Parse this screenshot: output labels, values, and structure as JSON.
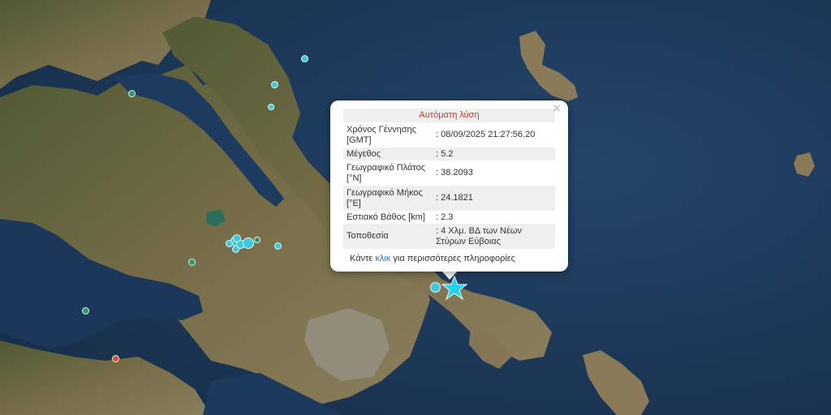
{
  "popup": {
    "title": "Αυτόματη λύση",
    "close_label": "×",
    "rows": [
      {
        "key": "Χρόνος Γέννησης [GMT]",
        "value": ": 08/09/2025 21:27:56.20"
      },
      {
        "key": "Μέγεθος",
        "value": ": 5.2"
      },
      {
        "key": "Γεωγραφικό Πλάτος [°N]",
        "value": ": 38.2093"
      },
      {
        "key": "Γεωγραφικό Μήκος [°E]",
        "value": ": 24.1821"
      },
      {
        "key": "Εστιακό Βάθος [km]",
        "value": ": 2.3"
      },
      {
        "key": "Τοποθεσία",
        "value": ": 4 Χλμ. ΒΔ των Νέων Στύρων Εύβοιας"
      }
    ],
    "footer_before": "Κάντε ",
    "footer_link": "κλικ",
    "footer_after": " για περισσότερες πληροφορίες"
  },
  "colors": {
    "sea": "#1c3a5a",
    "land": "#6e6a46",
    "recent_quake": "#3cc8dc",
    "older_quake": "#2a9a6a",
    "old_quake": "#d2522a",
    "star": "#22d4ea"
  },
  "markers": [
    {
      "category": "recent",
      "color": "#3cc8dc"
    },
    {
      "category": "recent",
      "color": "#3cc8dc"
    },
    {
      "category": "recent",
      "color": "#3cc8dc"
    },
    {
      "category": "older",
      "color": "#2a9a6a"
    },
    {
      "category": "older",
      "color": "#2a9a6a"
    },
    {
      "category": "older",
      "color": "#2a9a6a"
    },
    {
      "category": "recent",
      "color": "#3cc8dc"
    },
    {
      "category": "recent",
      "color": "#3cc8dc"
    },
    {
      "category": "recent",
      "color": "#3cc8dc"
    },
    {
      "category": "recent",
      "color": "#3cc8dc"
    },
    {
      "category": "recent",
      "color": "#3cc8dc"
    },
    {
      "category": "recent",
      "color": "#3cc8dc"
    },
    {
      "category": "recent",
      "color": "#3cc8dc"
    },
    {
      "category": "older",
      "color": "#2a9a6a"
    },
    {
      "category": "old",
      "color": "#d2522a"
    },
    {
      "category": "recent",
      "color": "#3cc8dc"
    }
  ],
  "epicenter_icon": "star-icon"
}
